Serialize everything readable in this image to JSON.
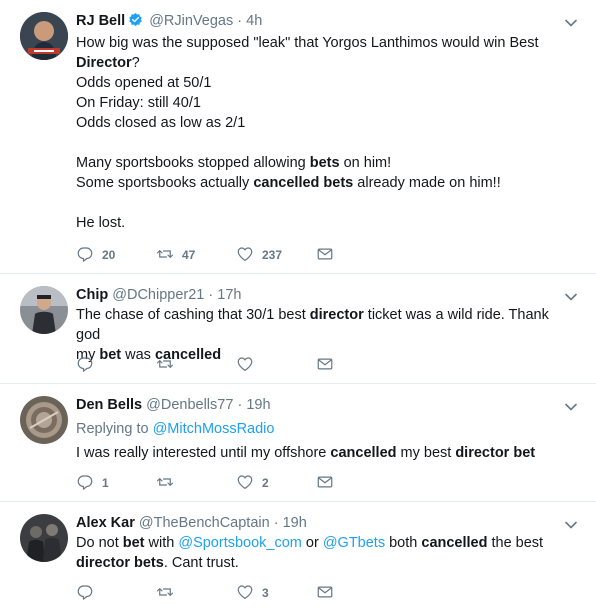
{
  "tweets": [
    {
      "name": "RJ Bell",
      "handle": "@RJinVegas",
      "dot": "·",
      "time": "4h",
      "verified": true,
      "lines": [
        [
          {
            "t": "How big was the supposed \"leak\" that Yorgos Lanthimos would win Best "
          }
        ],
        [
          {
            "t": "Director",
            "b": true
          },
          {
            "t": "?"
          }
        ],
        [
          {
            "t": "Odds opened at 50/1"
          }
        ],
        [
          {
            "t": "On Friday: still 40/1"
          }
        ],
        [
          {
            "t": "Odds closed as low as 2/1"
          }
        ],
        [],
        [
          {
            "t": "Many sportsbooks stopped allowing "
          },
          {
            "t": "bets",
            "b": true
          },
          {
            "t": " on him!"
          }
        ],
        [
          {
            "t": "Some sportsbooks actually "
          },
          {
            "t": "cancelled bets",
            "b": true
          },
          {
            "t": " already made on him!!"
          }
        ],
        [],
        [
          {
            "t": "He lost."
          }
        ]
      ],
      "counts": {
        "reply": "20",
        "retweet": "47",
        "like": "237"
      }
    },
    {
      "name": "Chip",
      "handle": "@DChipper21",
      "dot": "·",
      "time": "17h",
      "verified": false,
      "lines": [
        [
          {
            "t": "The chase of cashing that 30/1 best "
          },
          {
            "t": "director",
            "b": true
          },
          {
            "t": " ticket was a wild ride. Thank god"
          }
        ],
        [
          {
            "t": "my "
          },
          {
            "t": "bet",
            "b": true
          },
          {
            "t": " was "
          },
          {
            "t": "cancelled",
            "b": true
          }
        ]
      ],
      "counts": {
        "reply": "",
        "retweet": "",
        "like": ""
      }
    },
    {
      "name": "Den Bells",
      "handle": "@Denbells77",
      "dot": "·",
      "time": "19h",
      "verified": false,
      "replying_prefix": "Replying to ",
      "replying_to": "@MitchMossRadio",
      "lines": [
        [
          {
            "t": "I was really interested until my offshore "
          },
          {
            "t": "cancelled",
            "b": true
          },
          {
            "t": " my best "
          },
          {
            "t": "director bet",
            "b": true
          }
        ]
      ],
      "counts": {
        "reply": "1",
        "retweet": "",
        "like": "2"
      }
    },
    {
      "name": "Alex Kar",
      "handle": "@TheBenchCaptain",
      "dot": "·",
      "time": "19h",
      "verified": false,
      "lines": [
        [
          {
            "t": "Do not "
          },
          {
            "t": "bet",
            "b": true
          },
          {
            "t": " with "
          },
          {
            "t": "@Sportsbook_com",
            "l": true
          },
          {
            "t": " or "
          },
          {
            "t": "@GTbets",
            "l": true
          },
          {
            "t": " both "
          },
          {
            "t": "cancelled",
            "b": true
          },
          {
            "t": " the best"
          }
        ],
        [
          {
            "t": "director bets",
            "b": true
          },
          {
            "t": ".  Cant trust."
          }
        ]
      ],
      "counts": {
        "reply": "",
        "retweet": "",
        "like": "3"
      }
    }
  ],
  "icons": {
    "reply": "reply-icon",
    "retweet": "retweet-icon",
    "like": "like-icon",
    "message": "direct-message-icon",
    "caret": "chevron-down-icon",
    "verified": "verified-badge-icon"
  },
  "colors": {
    "accent": "#1da1f2",
    "muted": "#657786",
    "text": "#14171a",
    "divider": "#e6ecf0"
  }
}
